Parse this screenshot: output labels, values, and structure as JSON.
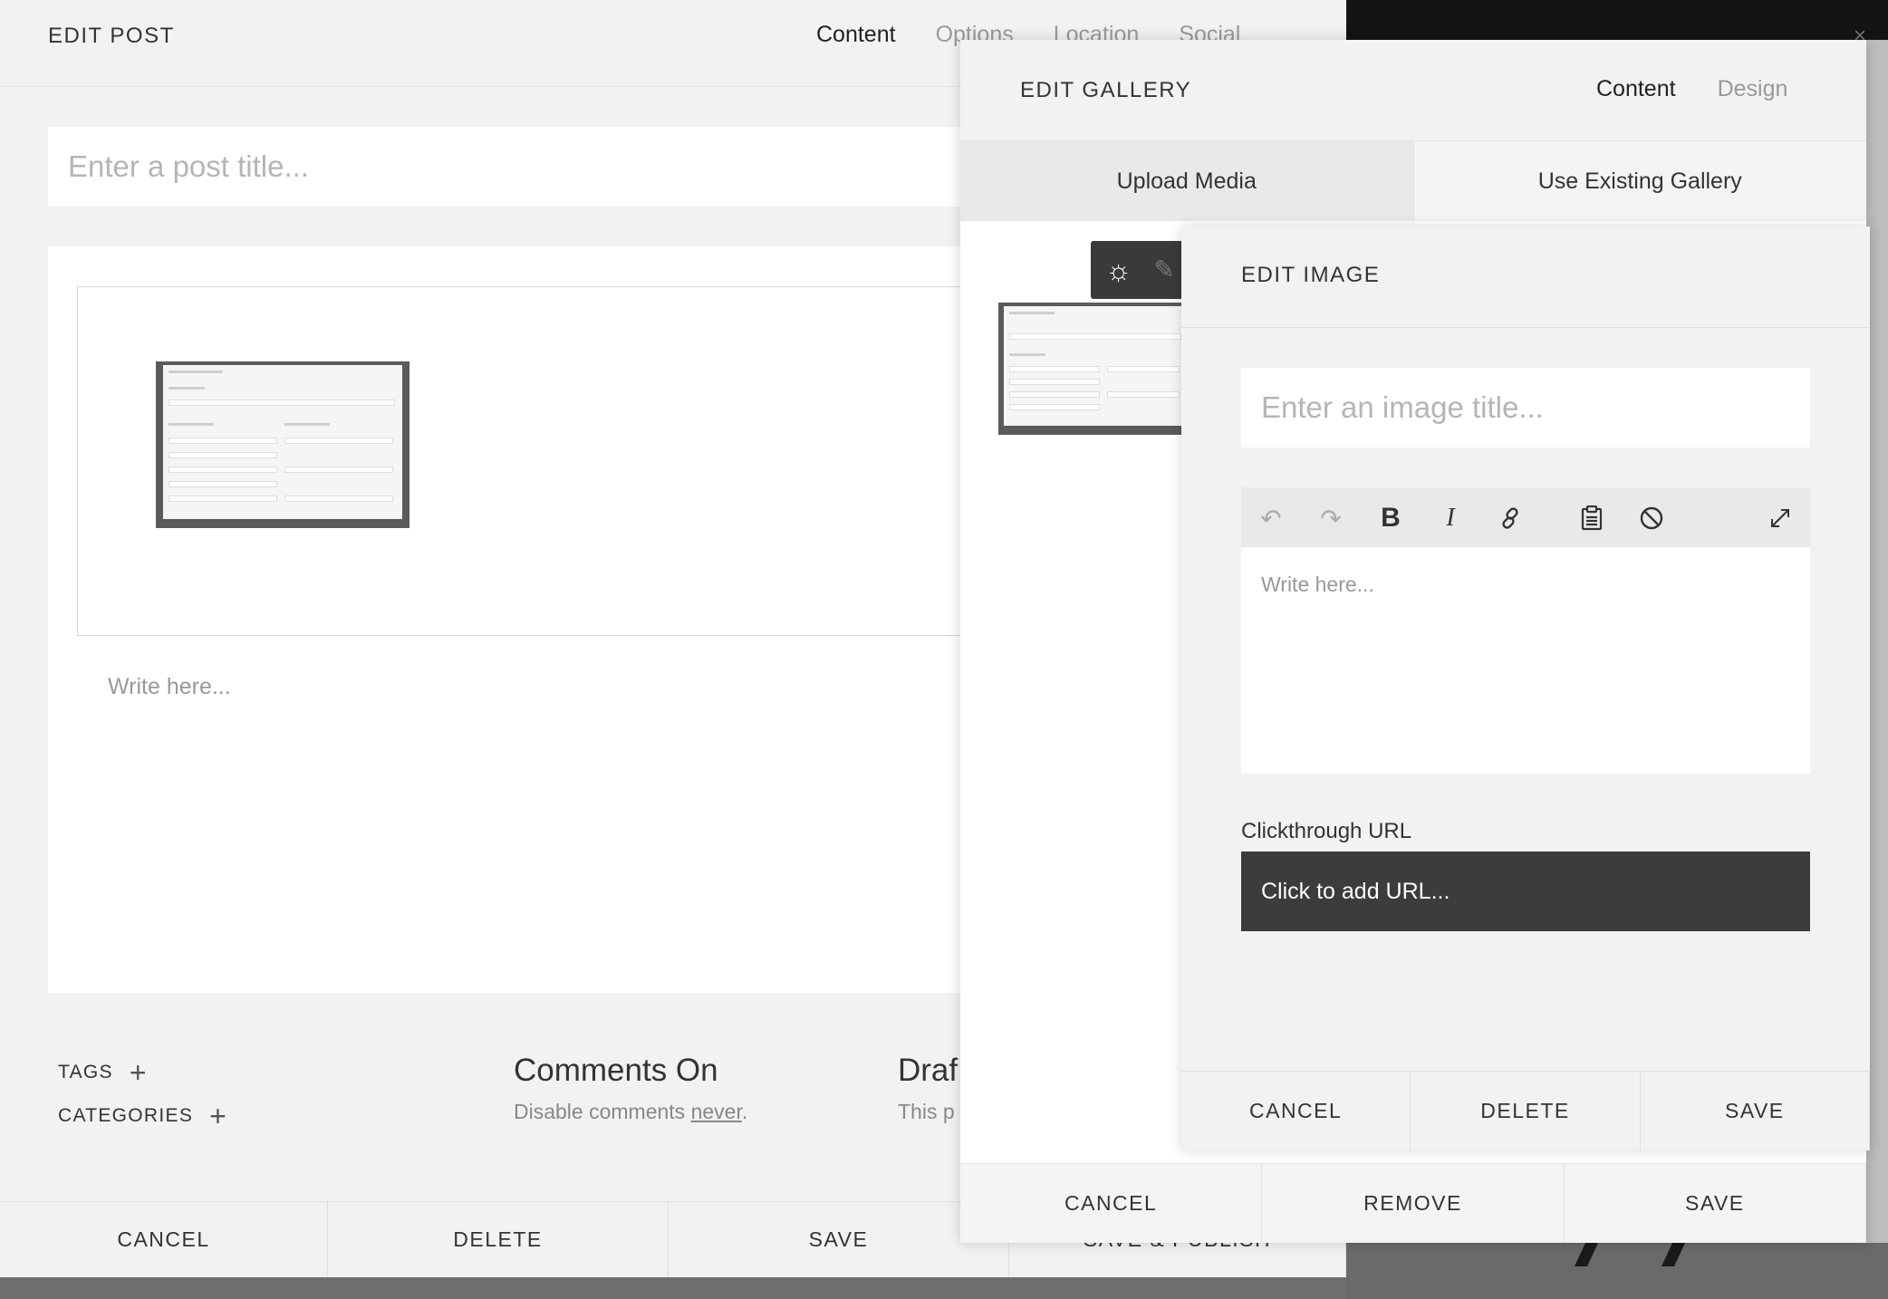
{
  "edit_post": {
    "title": "EDIT POST",
    "tabs": [
      "Content",
      "Options",
      "Location",
      "Social"
    ],
    "title_placeholder": "Enter a post title...",
    "body_placeholder": "Write here...",
    "tags_label": "TAGS",
    "categories_label": "CATEGORIES",
    "comments_heading": "Comments On",
    "comments_text_prefix": "Disable comments ",
    "comments_link": "never",
    "comments_text_suffix": ".",
    "draft_heading": "Draf",
    "draft_text": "This p",
    "footer": [
      "CANCEL",
      "DELETE",
      "SAVE",
      "SAVE & PUBLISH"
    ]
  },
  "edit_gallery": {
    "title": "EDIT GALLERY",
    "tabs": [
      "Content",
      "Design"
    ],
    "segments": [
      "Upload Media",
      "Use Existing Gallery"
    ],
    "toolbar_icons": [
      "settings-icon",
      "pencil-icon"
    ],
    "footer": [
      "CANCEL",
      "REMOVE",
      "SAVE"
    ]
  },
  "edit_image": {
    "title": "EDIT IMAGE",
    "title_placeholder": "Enter an image title...",
    "toolbar_icons": [
      "undo-icon",
      "redo-icon",
      "bold-icon",
      "italic-icon",
      "link-icon",
      "paste-icon",
      "clear-format-icon",
      "expand-icon"
    ],
    "body_placeholder": "Write here...",
    "url_label": "Clickthrough URL",
    "url_placeholder": "Click to add URL...",
    "footer": [
      "CANCEL",
      "DELETE",
      "SAVE"
    ]
  }
}
